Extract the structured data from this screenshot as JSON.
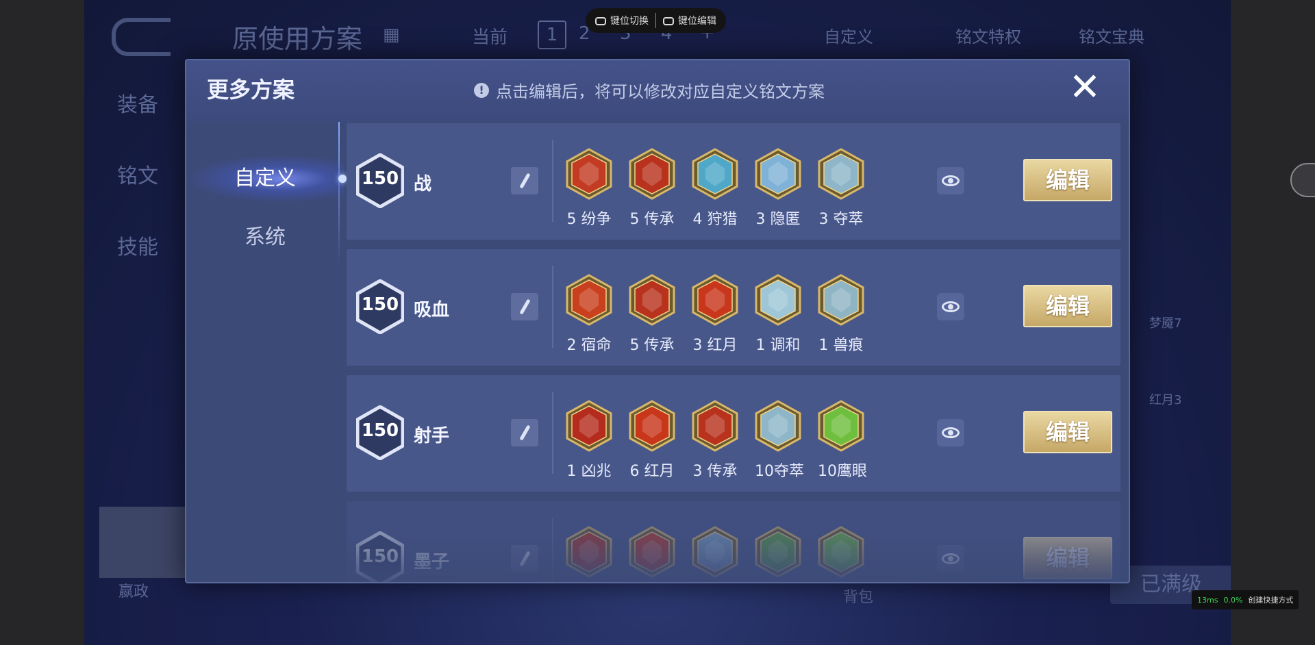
{
  "topbar": {
    "key_switch": "键位切换",
    "key_edit": "键位编辑"
  },
  "background": {
    "scheme_title": "原使用方案",
    "current_label": "当前",
    "page_current": "1",
    "pages": [
      "2",
      "3",
      "4"
    ],
    "add": "+",
    "custom_label": "自定义",
    "privilege": "铭文特权",
    "treasure": "铭文宝典",
    "side_tabs": [
      "装备",
      "铭文",
      "技能"
    ],
    "hero_name": "嬴政",
    "bag": "背包",
    "full_level": "已满级",
    "right_runes": [
      "梦魇7",
      "红月3"
    ]
  },
  "modal": {
    "title": "更多方案",
    "hint": "点击编辑后，将可以修改对应自定义铭文方案",
    "close": "✕",
    "tabs": [
      {
        "label": "自定义"
      },
      {
        "label": "系统"
      }
    ],
    "edit_label": "编辑",
    "rows": [
      {
        "level": "150",
        "name": "战",
        "runes": [
          {
            "label": "5 纷争",
            "color": "#c23b22"
          },
          {
            "label": "5 传承",
            "color": "#b8321e"
          },
          {
            "label": "4 狩猎",
            "color": "#4fa8c8"
          },
          {
            "label": "3 隐匿",
            "color": "#7fb2d6"
          },
          {
            "label": "3 夺萃",
            "color": "#8eb6c8"
          }
        ]
      },
      {
        "level": "150",
        "name": "吸血",
        "runes": [
          {
            "label": "2 宿命",
            "color": "#c9401e"
          },
          {
            "label": "5 传承",
            "color": "#b8321e"
          },
          {
            "label": "3 红月",
            "color": "#c8361c"
          },
          {
            "label": "1 调和",
            "color": "#9ec6d6"
          },
          {
            "label": "1 兽痕",
            "color": "#8fb4c4"
          }
        ]
      },
      {
        "level": "150",
        "name": "射手",
        "runes": [
          {
            "label": "1 凶兆",
            "color": "#b52c1e"
          },
          {
            "label": "6 红月",
            "color": "#c8361c"
          },
          {
            "label": "3 传承",
            "color": "#b8321e"
          },
          {
            "label": "10夺萃",
            "color": "#8eb6c8"
          },
          {
            "label": "10鹰眼",
            "color": "#6fbf3e"
          }
        ]
      },
      {
        "level": "150",
        "name": "墨子",
        "runes": [
          {
            "label": "",
            "color": "#b8321e"
          },
          {
            "label": "",
            "color": "#c8361c"
          },
          {
            "label": "",
            "color": "#7fa8c8"
          },
          {
            "label": "",
            "color": "#5ea83a"
          },
          {
            "label": "",
            "color": "#6fbf3e"
          }
        ]
      }
    ]
  },
  "perf": {
    "latency": "13ms",
    "loss": "0.0%",
    "shortcut": "创建快捷方式"
  }
}
